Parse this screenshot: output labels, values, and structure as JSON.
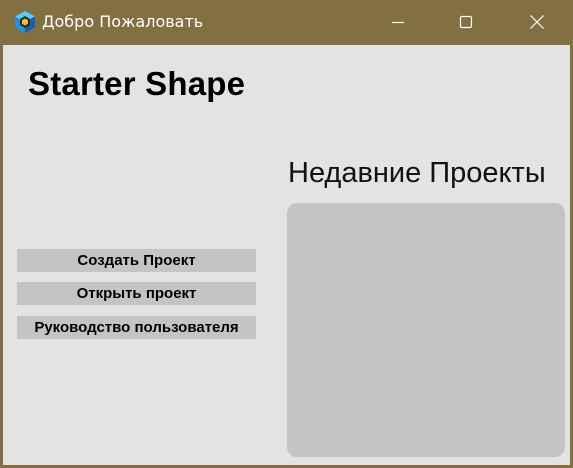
{
  "window": {
    "title": "Добро Пожаловать",
    "icon": "app-logo-hexagon-icon",
    "controls": [
      "minimize-icon",
      "maximize-icon",
      "close-icon"
    ]
  },
  "app": {
    "name": "Starter Shape"
  },
  "actions": {
    "create_label": "Создать Проект",
    "open_label": "Открыть проект",
    "guide_label": "Руководство пользователя"
  },
  "recent": {
    "heading": "Недавние Проекты",
    "items": []
  },
  "colors": {
    "titlebar": "#827043",
    "background": "#e3e3e3",
    "button": "#c4c4c4",
    "panel": "#c4c4c4"
  }
}
